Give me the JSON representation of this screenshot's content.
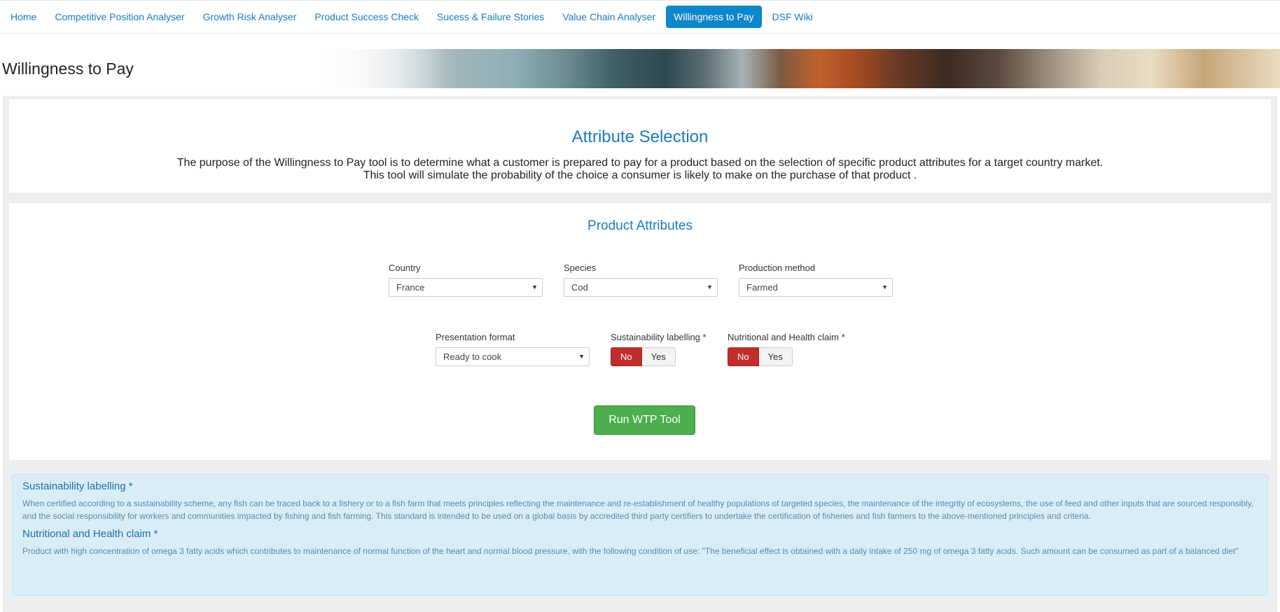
{
  "nav": {
    "items": [
      {
        "label": "Home",
        "active": false
      },
      {
        "label": "Competitive Position Analyser",
        "active": false
      },
      {
        "label": "Growth Risk Analyser",
        "active": false
      },
      {
        "label": "Product Success Check",
        "active": false
      },
      {
        "label": "Sucess & Failure Stories",
        "active": false
      },
      {
        "label": "Value Chain Analyser",
        "active": false
      },
      {
        "label": "Willingness to Pay",
        "active": true
      },
      {
        "label": "DSF Wiki",
        "active": false
      }
    ]
  },
  "banner": {
    "title": "Willingness to Pay"
  },
  "intro": {
    "heading": "Attribute Selection",
    "line1": "The purpose of the Willingness to Pay tool is to determine what a customer is prepared to pay for a product based on the selection of specific product attributes for a target country market.",
    "line2": "This tool will simulate the probability of the choice a consumer is likely to make on the purchase of that product ."
  },
  "attributes": {
    "heading": "Product Attributes",
    "country": {
      "label": "Country",
      "value": "France"
    },
    "species": {
      "label": "Species",
      "value": "Cod"
    },
    "production": {
      "label": "Production method",
      "value": "Farmed"
    },
    "presentation": {
      "label": "Presentation format",
      "value": "Ready to cook"
    },
    "sustainability": {
      "label": "Sustainability labelling *",
      "no": "No",
      "yes": "Yes",
      "selected": "No"
    },
    "nutrition": {
      "label": "Nutritional and Health claim *",
      "no": "No",
      "yes": "Yes",
      "selected": "No"
    },
    "run_label": "Run WTP Tool"
  },
  "info": {
    "sustainability_title": "Sustainability labelling *",
    "sustainability_text": "When certified according to a sustainability scheme, any fish can be traced back to a fishery or to a fish farm that meets principles reflecting the maintenance and re-establishment of healthy populations of targeted species, the maintenance of the integrity of ecosystems, the use of feed and other inputs that are sourced responsibly, and the social responsibility for workers and communities impacted by fishing and fish farming. This standard is intended to be used on a global basis by accredited third party certifiers to undertake the certification of fisheries and fish farmers to the above-mentioned principles and criteria.",
    "nutrition_title": "Nutritional and Health claim *",
    "nutrition_text": "Product with high concentration of omega 3 fatty acids which contributes to maintenance of normal function of the heart and normal blood pressure, with the following condition of use: \"The beneficial effect is obtained with a daily intake of 250 mg of omega 3 fatty acids. Such amount can be consumed as part of a balanced diet\""
  },
  "colors": {
    "accent": "#1a7bbf",
    "nav_active": "#0e86cc",
    "toggle_on": "#c12c2c",
    "run_button": "#4cae4c",
    "info_bg": "#d9edf7"
  }
}
